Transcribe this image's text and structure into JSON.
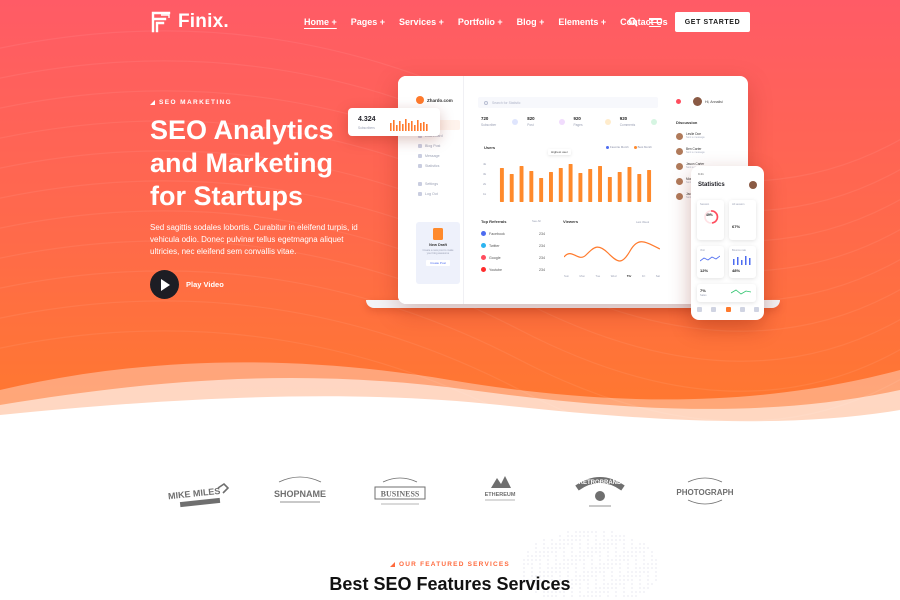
{
  "brand": {
    "name": "Finix.",
    "logo_icon": "finix-logo-icon",
    "accent_color": "#ff6a4a"
  },
  "nav": {
    "items": [
      {
        "label": "Home +",
        "active": true
      },
      {
        "label": "Pages +",
        "active": false
      },
      {
        "label": "Services +",
        "active": false
      },
      {
        "label": "Portfolio +",
        "active": false
      },
      {
        "label": "Blog +",
        "active": false
      },
      {
        "label": "Elements +",
        "active": false
      },
      {
        "label": "Contact Us",
        "active": false
      }
    ],
    "search_icon": "search-icon",
    "menu_icon": "hamburger-menu-icon",
    "cta_label": "GET STARTED"
  },
  "hero": {
    "eyebrow": "SEO MARKETING",
    "title_lines": [
      "SEO Analytics",
      "and Marketing",
      "for Startups"
    ],
    "description": "Sed sagittis sodales lobortis. Curabitur in eleifend turpis, id vehicula odio. Donec pulvinar tellus egetmagna aliquet ultricies, nec eleifend sem convallis vitae.",
    "play_label": "Play Video",
    "play_icon": "play-icon"
  },
  "dashboard": {
    "brand": "Zhardo.com",
    "search_placeholder": "Search for Statistic",
    "user_name": "Hi, Annalisi",
    "sidebar_items": [
      "Analytics",
      "Dashboard",
      "Blog Post",
      "Message",
      "Statistics",
      "Settings",
      "Log Out"
    ],
    "stats": [
      {
        "value": "720",
        "label": "Subscriber",
        "color": "#4d6cf0"
      },
      {
        "value": "820",
        "label": "Post",
        "color": "#c04df0"
      },
      {
        "value": "920",
        "label": "Pages",
        "color": "#ffb02c"
      },
      {
        "value": "920",
        "label": "Comments",
        "color": "#2cc46d"
      }
    ],
    "users_title": "Users",
    "users_legend": [
      "Favorite Month",
      "Best Month"
    ],
    "users_tooltip": "Highest user",
    "users_y_ticks": [
      "4k",
      "3k",
      "2k",
      "1k"
    ],
    "users_bars": [
      3.4,
      2.8,
      3.6,
      3.1,
      2.4,
      3.0,
      3.4,
      3.8,
      2.9,
      3.3,
      3.6,
      2.5,
      3.0,
      3.5,
      2.8,
      3.2
    ],
    "referrals_title": "Top Referrals",
    "referrals_see_all": "See All",
    "referrals": [
      {
        "name": "Facebook",
        "count": "234",
        "color": "#4d6cf0"
      },
      {
        "name": "Twitter",
        "count": "234",
        "color": "#2cb4f0"
      },
      {
        "name": "Google",
        "count": "234",
        "color": "#ff4d5e"
      },
      {
        "name": "Youtube",
        "count": "234",
        "color": "#ff2c2c"
      }
    ],
    "viewers_title": "Viewers",
    "viewers_select": "Last Week",
    "viewers_days": [
      "Sun",
      "Mon",
      "Tue",
      "Wed",
      "Thr",
      "Fri",
      "Sat"
    ],
    "viewers_active_day": "Thr",
    "discussion_title": "Discussion",
    "discussion": [
      {
        "name": "Leslie Doe",
        "sub": "Sent a message"
      },
      {
        "name": "Ben Carter",
        "sub": "Sent a message"
      },
      {
        "name": "Jason Carter",
        "sub": "Sent a message"
      },
      {
        "name": "Mona Lie",
        "sub": "Sent a message"
      },
      {
        "name": "Jacob Row",
        "sub": "Sent a message"
      }
    ],
    "draft_title": "New Draft",
    "draft_text": "Create a new post to make your blog awesome",
    "draft_button": "Create Post"
  },
  "mini_card": {
    "value": "4.324",
    "label": "Subscribers"
  },
  "phone": {
    "status_time": "9:41",
    "title": "Statistics",
    "tiles": [
      {
        "label": "Session",
        "value": "49%"
      },
      {
        "label": "All session",
        "value": "67%"
      },
      {
        "label": "Visit",
        "value": "12%"
      },
      {
        "label": "Bounce rate",
        "value": "48%"
      },
      {
        "label": "Sales",
        "value": "7%"
      }
    ]
  },
  "partners": [
    "MIKE MILES",
    "SHOPNAME",
    "BUSINESS",
    "ETHEREUM",
    "RETROBRAND",
    "PHOTOGRAPH"
  ],
  "features": {
    "eyebrow": "OUR FEATURED SERVICES",
    "title": "Best SEO Features Services"
  }
}
